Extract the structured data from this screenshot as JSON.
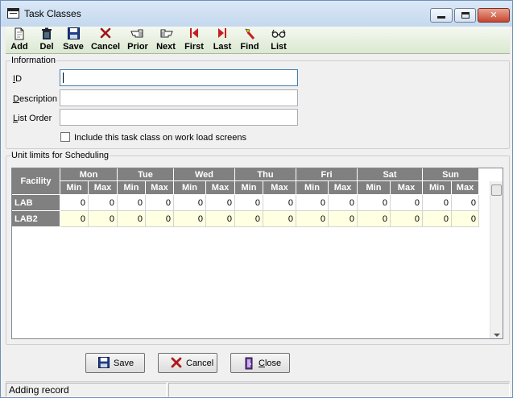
{
  "window": {
    "title": "Task Classes"
  },
  "toolbar": {
    "items": [
      {
        "label": "Add",
        "icon": "add-document-icon"
      },
      {
        "label": "Del",
        "icon": "trash-icon"
      },
      {
        "label": "Save",
        "icon": "floppy-disk-icon"
      },
      {
        "label": "Cancel",
        "icon": "x-icon"
      },
      {
        "label": "Prior",
        "icon": "hand-left-icon"
      },
      {
        "label": "Next",
        "icon": "hand-right-icon"
      },
      {
        "label": "First",
        "icon": "first-arrow-icon"
      },
      {
        "label": "Last",
        "icon": "last-arrow-icon"
      },
      {
        "label": "Find",
        "icon": "flashlight-icon"
      },
      {
        "label": "List",
        "icon": "glasses-icon"
      }
    ]
  },
  "information": {
    "legend": "Information",
    "id_label_u": "I",
    "id_label_rest": "D",
    "id_value": "",
    "description_label_u": "D",
    "description_label_rest": "escription",
    "description_value": "",
    "list_order_label_u": "L",
    "list_order_label_rest": "ist Order",
    "list_order_value": "",
    "include_checkbox_label": "Include this task class on work load screens",
    "include_checked": false
  },
  "unit_limits": {
    "legend": "Unit limits for Scheduling",
    "facility_header": "Facility",
    "days": [
      "Mon",
      "Tue",
      "Wed",
      "Thu",
      "Fri",
      "Sat",
      "Sun"
    ],
    "min_label": "Min",
    "max_label": "Max",
    "rows": [
      {
        "facility": "LAB",
        "values": [
          "0",
          "0",
          "0",
          "0",
          "0",
          "0",
          "0",
          "0",
          "0",
          "0",
          "0",
          "0",
          "0",
          "0"
        ]
      },
      {
        "facility": "LAB2",
        "values": [
          "0",
          "0",
          "0",
          "0",
          "0",
          "0",
          "0",
          "0",
          "0",
          "0",
          "0",
          "0",
          "0",
          "0"
        ]
      }
    ]
  },
  "buttons": {
    "save": "Save",
    "cancel": "Cancel",
    "close_u": "C",
    "close_rest": "lose"
  },
  "status": {
    "text": "Adding record",
    "secondary": ""
  },
  "colors": {
    "header_gray": "#808080",
    "row_alt": "#ffffe1",
    "red_icon": "#c81e1e",
    "blue_icon": "#1e3c8c"
  }
}
